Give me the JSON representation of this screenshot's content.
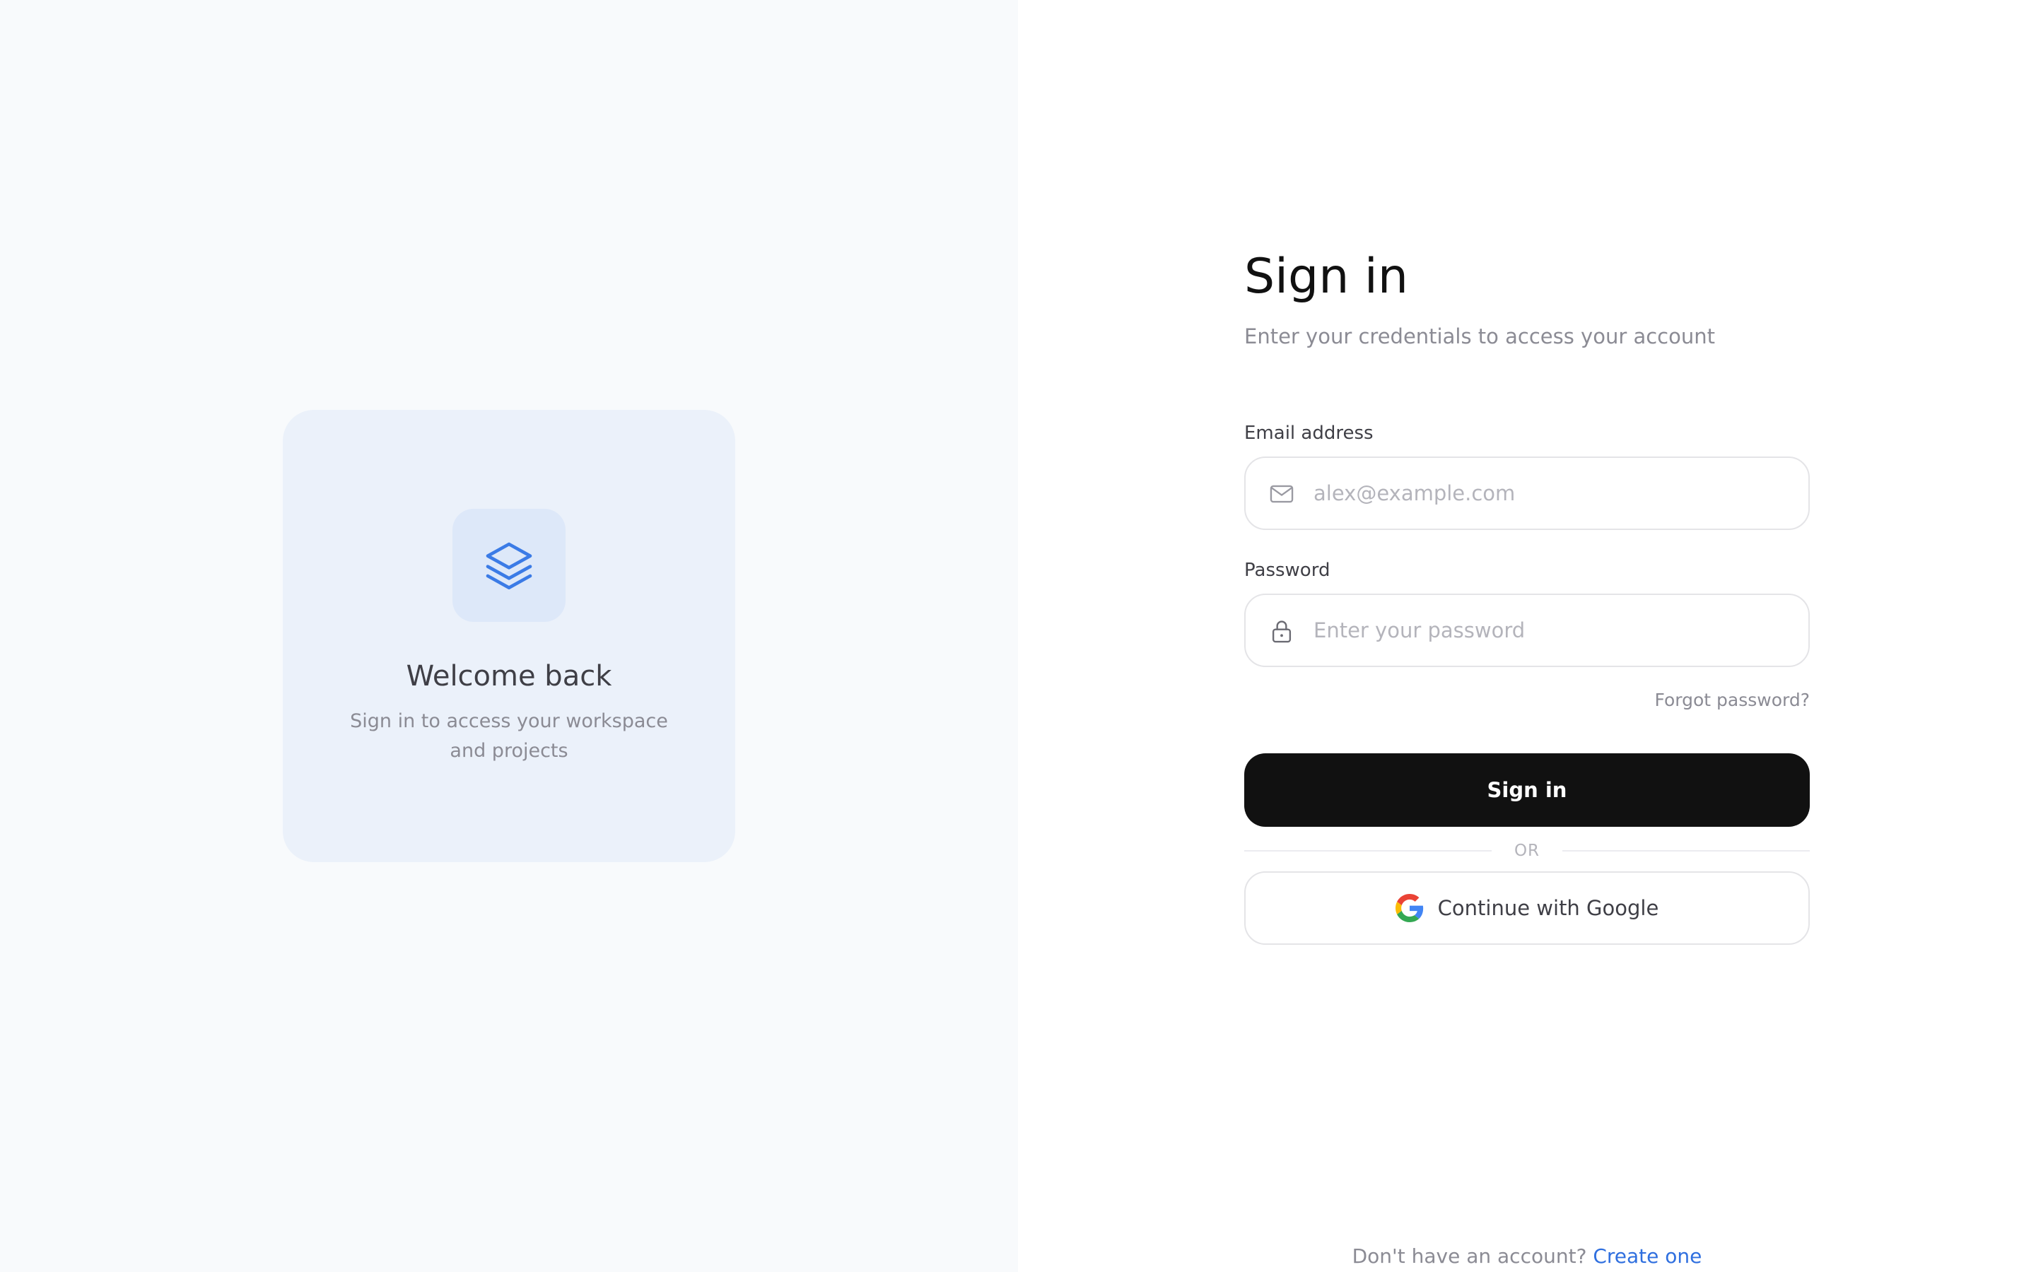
{
  "welcome": {
    "title": "Welcome back",
    "subtitle": "Sign in to access your workspace and projects",
    "logo_icon": "layers-icon",
    "accent_color": "#3b7be6"
  },
  "signin": {
    "title": "Sign in",
    "subtitle": "Enter your credentials to access your account"
  },
  "email": {
    "label": "Email address",
    "placeholder": "alex@example.com",
    "value": "",
    "icon": "mail-icon"
  },
  "password": {
    "label": "Password",
    "placeholder": "Enter your password",
    "value": "",
    "icon": "lock-icon"
  },
  "forgot_label": "Forgot password?",
  "submit_label": "Sign in",
  "divider_label": "OR",
  "google": {
    "label": "Continue with Google",
    "icon": "google-icon"
  },
  "signup": {
    "prompt": "Don't have an account?",
    "link_label": "Create one"
  },
  "colors": {
    "primary_button": "#111111",
    "link": "#2f6fdf",
    "left_panel_bg": "#f8fafc",
    "card_bg": "#ebf1fa"
  }
}
